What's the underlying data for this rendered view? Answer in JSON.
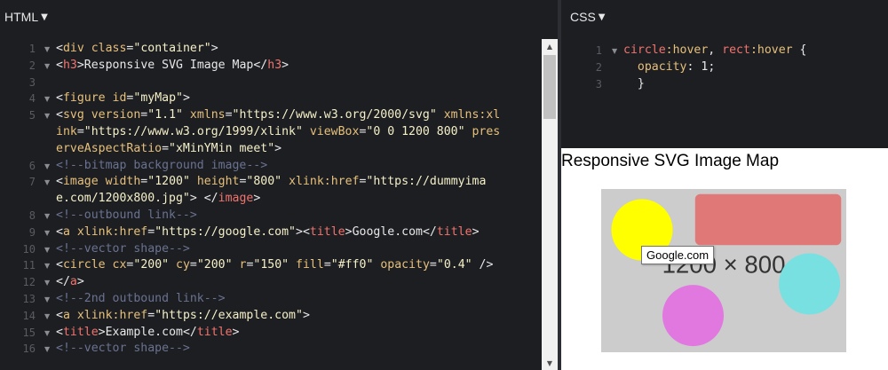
{
  "html_pane": {
    "title": "HTML",
    "lines": [
      {
        "n": "1",
        "fold": true,
        "segs": [
          [
            "br",
            "<"
          ],
          [
            "tag",
            "div "
          ],
          [
            "attr",
            "class"
          ],
          [
            "br",
            "="
          ],
          [
            "str",
            "\"container\""
          ],
          [
            "br",
            ">"
          ]
        ]
      },
      {
        "n": "2",
        "fold": true,
        "segs": [
          [
            "br",
            "<"
          ],
          [
            "tag-r",
            "h3"
          ],
          [
            "br",
            ">"
          ],
          [
            "plain",
            "Responsive SVG Image Map"
          ],
          [
            "br",
            "</"
          ],
          [
            "tag-r",
            "h3"
          ],
          [
            "br",
            ">"
          ]
        ]
      },
      {
        "n": "3",
        "fold": false,
        "segs": []
      },
      {
        "n": "4",
        "fold": true,
        "segs": [
          [
            "br",
            "<"
          ],
          [
            "tag",
            "figure "
          ],
          [
            "attr",
            "id"
          ],
          [
            "br",
            "="
          ],
          [
            "str",
            "\"myMap\""
          ],
          [
            "br",
            ">"
          ]
        ]
      },
      {
        "n": "5",
        "fold": true,
        "segs": [
          [
            "br",
            "<"
          ],
          [
            "tag",
            "svg "
          ],
          [
            "attr",
            "version"
          ],
          [
            "br",
            "="
          ],
          [
            "str",
            "\"1.1\" "
          ],
          [
            "attr",
            "xmlns"
          ],
          [
            "br",
            "="
          ],
          [
            "str",
            "\"https://www.w3.org/2000/svg\" "
          ],
          [
            "attr",
            "xmlns:xl"
          ]
        ]
      },
      {
        "n": "",
        "fold": false,
        "segs": [
          [
            "attr",
            "ink"
          ],
          [
            "br",
            "="
          ],
          [
            "str",
            "\"https://www.w3.org/1999/xlink\" "
          ],
          [
            "attr",
            "viewBox"
          ],
          [
            "br",
            "="
          ],
          [
            "str",
            "\"0 0 1200 800\" "
          ],
          [
            "attr",
            "pres"
          ]
        ]
      },
      {
        "n": "",
        "fold": false,
        "segs": [
          [
            "attr",
            "erveAspectRatio"
          ],
          [
            "br",
            "="
          ],
          [
            "str",
            "\"xMinYMin meet\""
          ],
          [
            "br",
            ">"
          ]
        ]
      },
      {
        "n": "6",
        "fold": true,
        "segs": [
          [
            "cmt",
            "<!--bitmap background image-->"
          ]
        ]
      },
      {
        "n": "7",
        "fold": true,
        "segs": [
          [
            "br",
            "<"
          ],
          [
            "tag",
            "image "
          ],
          [
            "attr",
            "width"
          ],
          [
            "br",
            "="
          ],
          [
            "str",
            "\"1200\" "
          ],
          [
            "attr",
            "height"
          ],
          [
            "br",
            "="
          ],
          [
            "str",
            "\"800\" "
          ],
          [
            "attr",
            "xlink:href"
          ],
          [
            "br",
            "="
          ],
          [
            "str",
            "\"https://dummyima"
          ]
        ]
      },
      {
        "n": "",
        "fold": false,
        "segs": [
          [
            "str",
            "e.com/1200x800.jpg\""
          ],
          [
            "br",
            "> </"
          ],
          [
            "tag-r",
            "image"
          ],
          [
            "br",
            ">"
          ]
        ]
      },
      {
        "n": "8",
        "fold": true,
        "segs": [
          [
            "cmt",
            "<!--outbound link-->"
          ]
        ]
      },
      {
        "n": "9",
        "fold": true,
        "segs": [
          [
            "br",
            "<"
          ],
          [
            "tag",
            "a "
          ],
          [
            "attr",
            "xlink:href"
          ],
          [
            "br",
            "="
          ],
          [
            "str",
            "\"https://google.com\""
          ],
          [
            "br",
            ">"
          ],
          [
            "br",
            "<"
          ],
          [
            "tag-r",
            "title"
          ],
          [
            "br",
            ">"
          ],
          [
            "plain",
            "Google.com"
          ],
          [
            "br",
            "</"
          ],
          [
            "tag-r",
            "title"
          ],
          [
            "br",
            ">"
          ]
        ]
      },
      {
        "n": "10",
        "fold": true,
        "segs": [
          [
            "cmt",
            "<!--vector shape-->"
          ]
        ]
      },
      {
        "n": "11",
        "fold": true,
        "segs": [
          [
            "br",
            "<"
          ],
          [
            "tag",
            "circle "
          ],
          [
            "attr",
            "cx"
          ],
          [
            "br",
            "="
          ],
          [
            "str",
            "\"200\" "
          ],
          [
            "attr",
            "cy"
          ],
          [
            "br",
            "="
          ],
          [
            "str",
            "\"200\" "
          ],
          [
            "attr",
            "r"
          ],
          [
            "br",
            "="
          ],
          [
            "str",
            "\"150\" "
          ],
          [
            "attr",
            "fill"
          ],
          [
            "br",
            "="
          ],
          [
            "str",
            "\"#ff0\" "
          ],
          [
            "attr",
            "opacity"
          ],
          [
            "br",
            "="
          ],
          [
            "str",
            "\"0.4\""
          ],
          [
            "br",
            " />"
          ]
        ]
      },
      {
        "n": "12",
        "fold": true,
        "segs": [
          [
            "br",
            "</"
          ],
          [
            "tag-r",
            "a"
          ],
          [
            "br",
            ">"
          ]
        ]
      },
      {
        "n": "13",
        "fold": true,
        "segs": [
          [
            "cmt",
            "<!--2nd outbound link-->"
          ]
        ]
      },
      {
        "n": "14",
        "fold": true,
        "segs": [
          [
            "br",
            "<"
          ],
          [
            "tag",
            "a "
          ],
          [
            "attr",
            "xlink:href"
          ],
          [
            "br",
            "="
          ],
          [
            "str",
            "\"https://example.com\""
          ],
          [
            "br",
            ">"
          ]
        ]
      },
      {
        "n": "15",
        "fold": true,
        "segs": [
          [
            "br",
            "<"
          ],
          [
            "tag-r",
            "title"
          ],
          [
            "br",
            ">"
          ],
          [
            "plain",
            "Example.com"
          ],
          [
            "br",
            "</"
          ],
          [
            "tag-r",
            "title"
          ],
          [
            "br",
            ">"
          ]
        ]
      },
      {
        "n": "16",
        "fold": true,
        "segs": [
          [
            "cmt",
            "<!--vector shape-->"
          ]
        ]
      }
    ]
  },
  "css_pane": {
    "title": "CSS",
    "lines": [
      {
        "n": "1",
        "fold": true,
        "segs": [
          [
            "sel",
            "circle"
          ],
          [
            "pcl",
            ":hover"
          ],
          [
            "plain",
            ", "
          ],
          [
            "sel",
            "rect"
          ],
          [
            "pcl",
            ":hover"
          ],
          [
            "plain",
            " {"
          ]
        ]
      },
      {
        "n": "2",
        "fold": false,
        "segs": [
          [
            "plain",
            "  "
          ],
          [
            "prop",
            "opacity"
          ],
          [
            "plain",
            ": "
          ],
          [
            "num",
            "1"
          ],
          [
            "plain",
            ";"
          ]
        ]
      },
      {
        "n": "3",
        "fold": false,
        "segs": [
          [
            "plain",
            "  }"
          ]
        ]
      }
    ]
  },
  "preview": {
    "heading": "Responsive SVG Image Map",
    "image_label": "1200 × 800",
    "tooltip": "Google.com",
    "colors": {
      "background": "#cccccc",
      "circle_yellow": "#ffff00",
      "rect_red": "#e07878",
      "circle_cyan": "#78e0e0",
      "circle_magenta": "#e078e0"
    }
  }
}
